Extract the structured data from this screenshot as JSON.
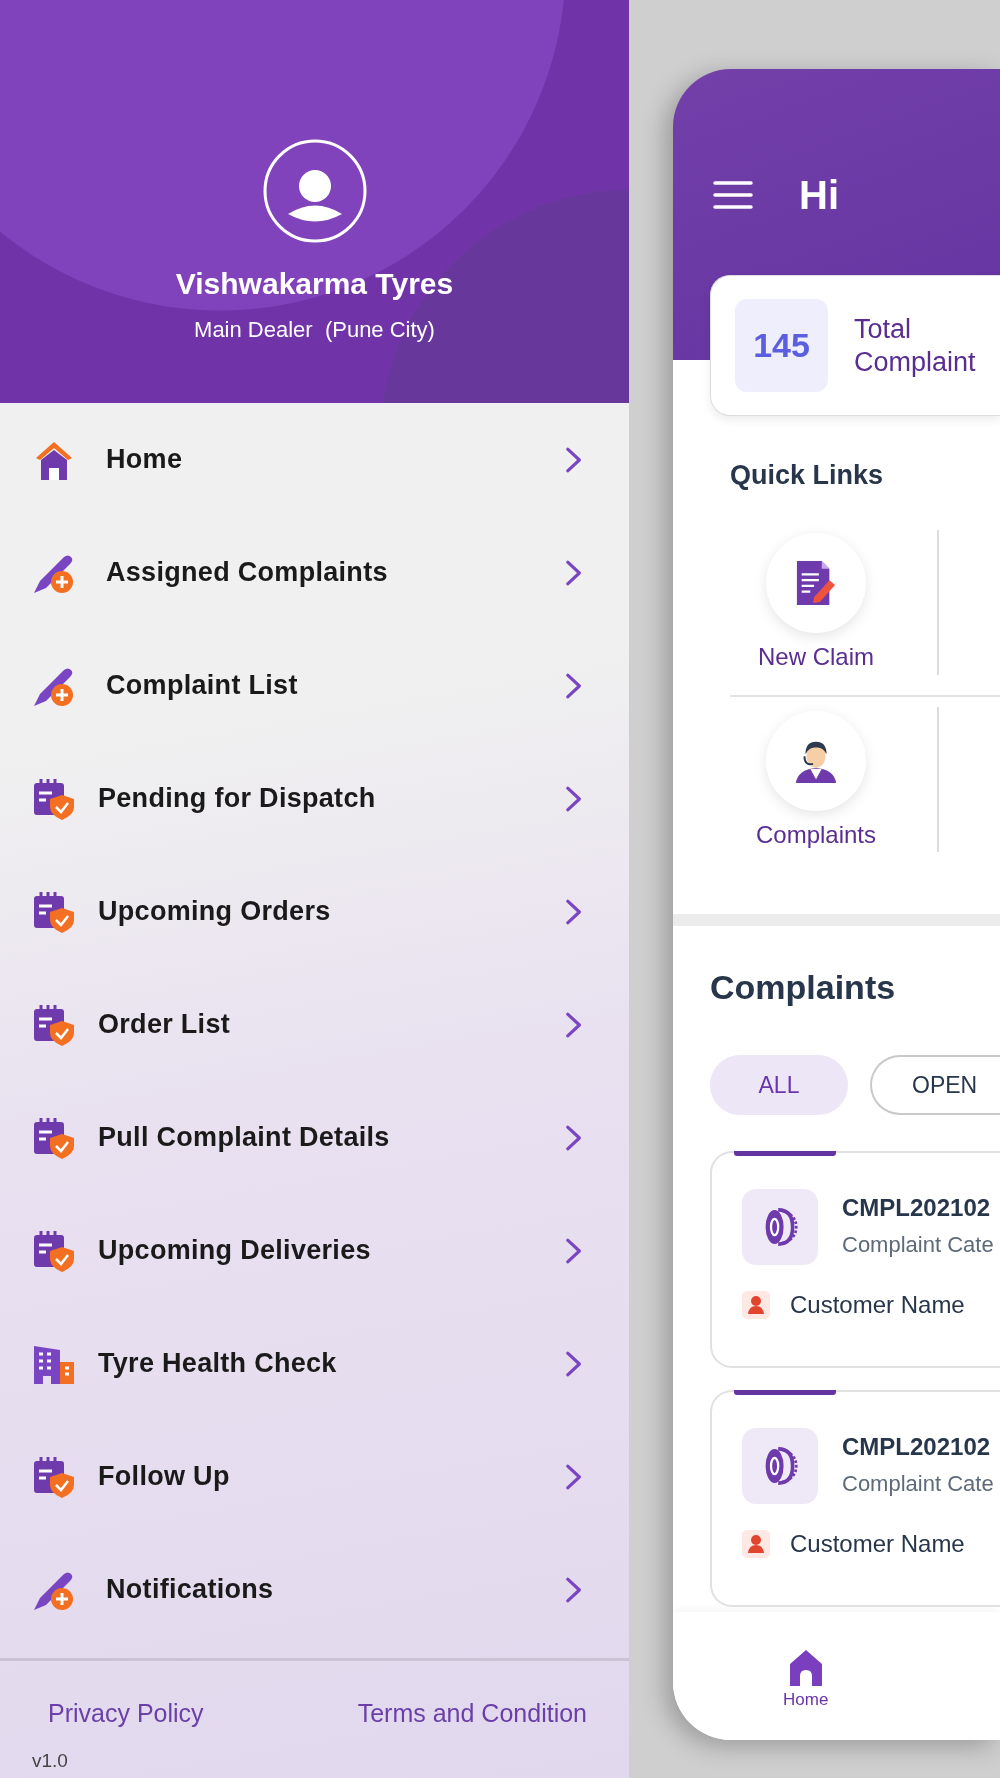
{
  "drawer": {
    "profile": {
      "name": "Vishwakarma Tyres",
      "role": "Main Dealer  (Pune City)"
    },
    "menu": [
      {
        "label": "Home",
        "kind": "home"
      },
      {
        "label": "Assigned Complaints",
        "kind": "compose"
      },
      {
        "label": "Complaint List",
        "kind": "compose"
      },
      {
        "label": "Pending for Dispatch",
        "kind": "schedule"
      },
      {
        "label": "Upcoming Orders",
        "kind": "schedule"
      },
      {
        "label": "Order List",
        "kind": "schedule"
      },
      {
        "label": "Pull Complaint Details",
        "kind": "schedule"
      },
      {
        "label": "Upcoming Deliveries",
        "kind": "schedule"
      },
      {
        "label": "Tyre Health Check",
        "kind": "building"
      },
      {
        "label": "Follow Up",
        "kind": "schedule"
      },
      {
        "label": "Notifications",
        "kind": "compose"
      }
    ],
    "footer_links": [
      "Privacy Policy",
      "Terms and Condition"
    ],
    "version": "v1.0"
  },
  "home_screen": {
    "greeting": "Hi",
    "summary": {
      "count": "145",
      "label": "Total Complaint"
    },
    "quick_links": {
      "title": "Quick Links",
      "items": [
        {
          "label": "New Claim",
          "kind": "claim"
        },
        {
          "label": "Complaints",
          "kind": "agent"
        }
      ]
    },
    "complaints": {
      "title": "Complaints",
      "filters": [
        {
          "label": "ALL",
          "selected": true
        },
        {
          "label": "OPEN",
          "selected": false
        }
      ],
      "cards": [
        {
          "id": "CMPL202102",
          "category": "Complaint Cate",
          "customer": "Customer Name"
        },
        {
          "id": "CMPL202102",
          "category": "Complaint Cate",
          "customer": "Customer Name"
        }
      ]
    },
    "bottom_nav": [
      {
        "label": "Home",
        "selected": true
      }
    ]
  }
}
